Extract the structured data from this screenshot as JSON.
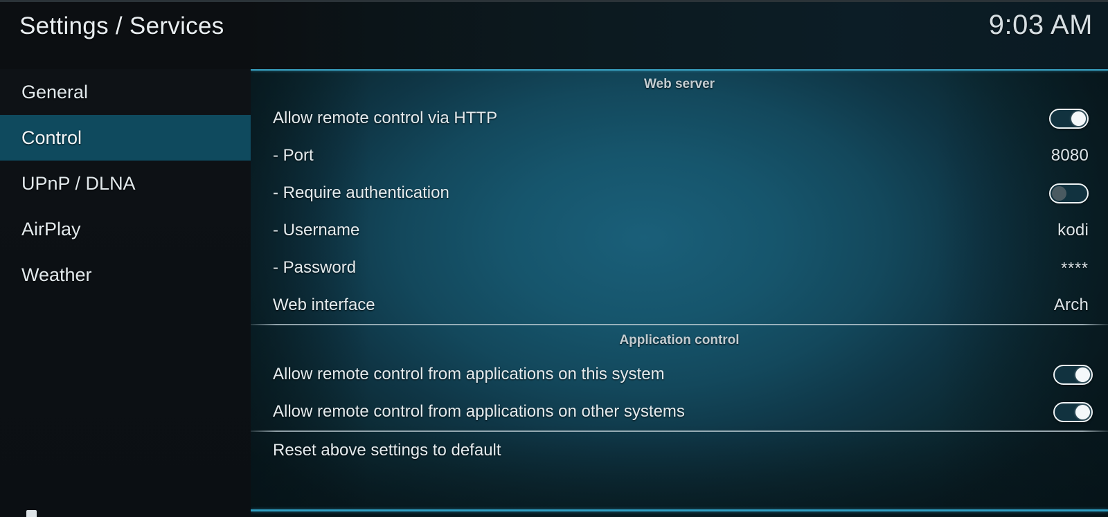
{
  "header": {
    "title": "Settings / Services",
    "clock": "9:03 AM"
  },
  "sidebar": {
    "items": [
      {
        "label": "General",
        "selected": false
      },
      {
        "label": "Control",
        "selected": true
      },
      {
        "label": "UPnP / DLNA",
        "selected": false
      },
      {
        "label": "AirPlay",
        "selected": false
      },
      {
        "label": "Weather",
        "selected": false
      }
    ],
    "bottom_icon": "settings-level-icon"
  },
  "colors": {
    "accent_rule": "#39a3c4",
    "selection": "#0f4a5e",
    "panel_center": "#155069",
    "sidebar": "#0c1014",
    "text": "#e4ebee"
  },
  "sections": [
    {
      "title": "Web server",
      "rows": [
        {
          "label": "Allow remote control via HTTP",
          "control": "toggle",
          "state": "on"
        },
        {
          "label": "- Port",
          "control": "value",
          "value": "8080"
        },
        {
          "label": "- Require authentication",
          "control": "toggle",
          "state": "off"
        },
        {
          "label": "- Username",
          "control": "value",
          "value": "kodi"
        },
        {
          "label": "- Password",
          "control": "value",
          "value": "****"
        },
        {
          "label": "Web interface",
          "control": "value",
          "value": "Arch"
        }
      ]
    },
    {
      "title": "Application control",
      "rows": [
        {
          "label": "Allow remote control from applications on this system",
          "control": "toggle",
          "state": "on"
        },
        {
          "label": "Allow remote control from applications on other systems",
          "control": "toggle",
          "state": "on"
        }
      ]
    },
    {
      "title": "",
      "rows": [
        {
          "label": "Reset above settings to default",
          "control": "none",
          "value": ""
        }
      ]
    }
  ]
}
